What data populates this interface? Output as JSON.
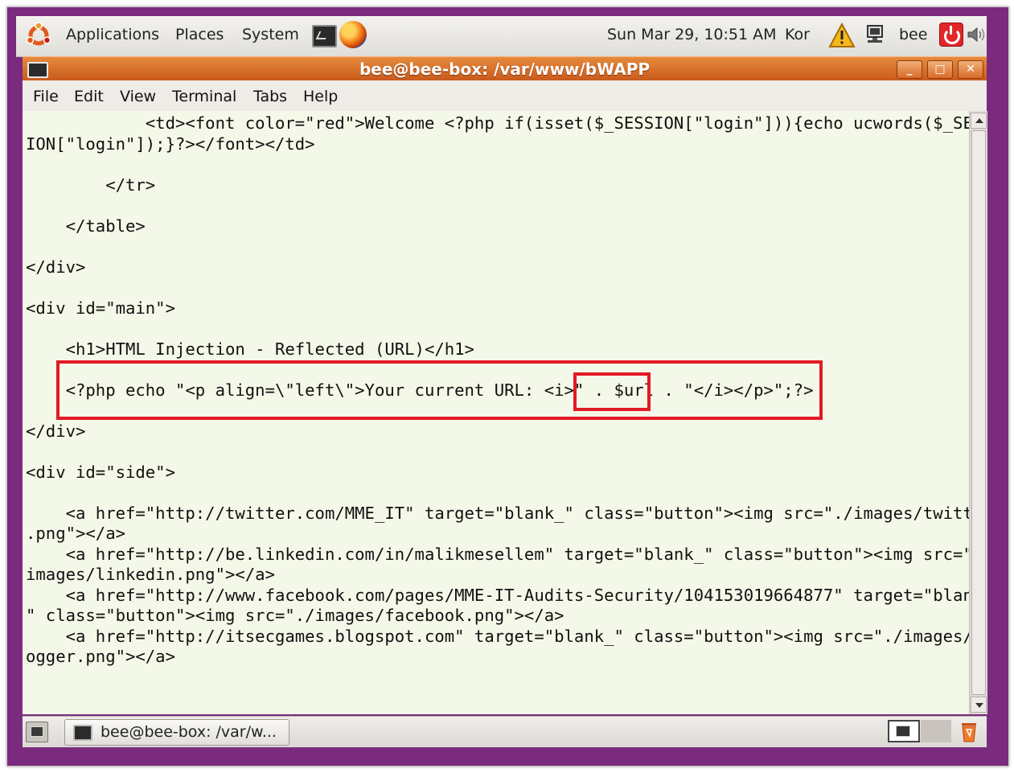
{
  "top_panel": {
    "menus": [
      "Applications",
      "Places",
      "System"
    ],
    "clock": "Sun Mar 29, 10:51 AM",
    "keyboard_layout": "Kor",
    "user": "bee",
    "icons": [
      "ubuntu-logo-icon",
      "terminal-icon",
      "firefox-icon",
      "warning-icon",
      "network-icon",
      "power-icon",
      "volume-icon"
    ]
  },
  "window": {
    "title": "bee@bee-box: /var/www/bWAPP",
    "controls": {
      "minimize": "_",
      "maximize": "□",
      "close": "✕"
    }
  },
  "menubar": {
    "items": [
      "File",
      "Edit",
      "View",
      "Terminal",
      "Tabs",
      "Help"
    ]
  },
  "terminal": {
    "lines": [
      "            <td><font color=\"red\">Welcome <?php if(isset($_SESSION[\"login\"])){echo ucwords($_SESS",
      "ION[\"login\"]);}?></font></td>",
      "",
      "        </tr>",
      "",
      "    </table>",
      "",
      "</div>",
      "",
      "<div id=\"main\">",
      "",
      "    <h1>HTML Injection - Reflected (URL)</h1>",
      "",
      "    <?php echo \"<p align=\\\"left\\\">Your current URL: <i>\" . $url . \"</i></p>\";?>",
      "",
      "</div>",
      "",
      "<div id=\"side\">",
      "",
      "    <a href=\"http://twitter.com/MME_IT\" target=\"blank_\" class=\"button\"><img src=\"./images/twitter",
      ".png\"></a>",
      "    <a href=\"http://be.linkedin.com/in/malikmesellem\" target=\"blank_\" class=\"button\"><img src=\"./",
      "images/linkedin.png\"></a>",
      "    <a href=\"http://www.facebook.com/pages/MME-IT-Audits-Security/104153019664877\" target=\"blank_",
      "\" class=\"button\"><img src=\"./images/facebook.png\"></a>",
      "    <a href=\"http://itsecgames.blogspot.com\" target=\"blank_\" class=\"button\"><img src=\"./images/bl",
      "ogger.png\"></a>"
    ]
  },
  "taskbar": {
    "task_label": "bee@bee-box: /var/w..."
  },
  "colors": {
    "frame": "#7b2b7e",
    "titlebar": "#d86a28",
    "terminal_bg": "#f4f8e8",
    "highlight": "#e21a24"
  }
}
